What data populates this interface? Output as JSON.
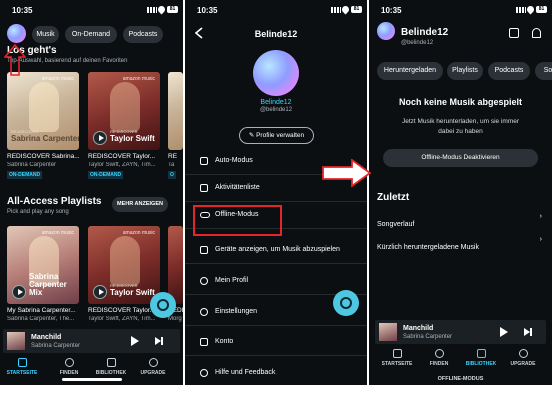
{
  "panel1": {
    "time": "10:35",
    "battery": "81",
    "chips": [
      "Musik",
      "On-Demand",
      "Podcasts"
    ],
    "section1": {
      "title": "Los geht's",
      "subtitle": "Top-Auswahl, basierend auf deinen Favoriten"
    },
    "cards1": [
      {
        "tag": "RE:DISCOVER",
        "overlay": "Sabrina Carpenter",
        "title": "REDISCOVER Sabrina...",
        "artists": "Sabrina Carpenter",
        "badge": "ON-DEMAND",
        "brand": "amazon music"
      },
      {
        "tag": "RE:DISCOVER",
        "overlay": "Taylor Swift",
        "title": "REDISCOVER Taylor...",
        "artists": "Taylor Swift, ZAYN, Tim...",
        "badge": "ON-DEMAND",
        "brand": "amazon music"
      },
      {
        "title": "RE",
        "artists": "Ta",
        "badge": "O"
      }
    ],
    "section2": {
      "title": "All-Access Playlists",
      "subtitle": "Pick and play any song",
      "more": "MEHR ANZEIGEN"
    },
    "cards2": [
      {
        "overlay": "Sabrina\nCarpenter Mix",
        "title": "My Sabrina Carpenter...",
        "artists": "Sabrina Carpenter, The...",
        "brand": "amazon music"
      },
      {
        "tag": "RE:DISCOVER",
        "overlay": "Taylor Swift",
        "title": "REDISCOVER Taylor...",
        "artists": "Taylor Swift, ZAYN, Tim...",
        "brand": "amazon music"
      },
      {
        "title": "REDI",
        "artists": "Morg"
      }
    ],
    "mini": {
      "title": "Manchild",
      "artist": "Sabrina Carpenter"
    },
    "tabs": [
      "STARTSEITE",
      "FINDEN",
      "BIBLIOTHEK",
      "UPGRADE"
    ]
  },
  "panel2": {
    "time": "10:35",
    "battery": "81",
    "header": "Belinde12",
    "name": "Belinde12",
    "handle": "@belinde12",
    "manage": "Profile verwalten",
    "menu": [
      "Auto-Modus",
      "Aktivitätenliste",
      "Offline-Modus",
      "Geräte anzeigen, um Musik abzuspielen",
      "Mein Profil",
      "Einstellungen",
      "Konto",
      "Hilfe und Feedback"
    ]
  },
  "panel3": {
    "time": "10:35",
    "battery": "81",
    "name": "Belinde12",
    "handle": "@belinde12",
    "chips": [
      "Heruntergeladen",
      "Playlists",
      "Podcasts",
      "Son"
    ],
    "empty_title": "Noch keine Musik abgespielt",
    "empty_text": "Jetzt Musik herunterladen, um sie immer dabei zu haben",
    "offline_btn": "Offline-Modus Deaktivieren",
    "recent_title": "Zuletzt",
    "recent_items": [
      "Songverlauf",
      "Kürzlich heruntergeladene Musik"
    ],
    "mini": {
      "title": "Manchild",
      "artist": "Sabrina Carpenter"
    },
    "tabs": [
      "STARTSEITE",
      "FINDEN",
      "BIBLIOTHEK",
      "UPGRADE"
    ],
    "offline_banner": "OFFLINE-MODUS"
  },
  "colors": {
    "accent": "#39d4ff",
    "highlight_red": "#e3262a",
    "background": "#0b0f12"
  }
}
